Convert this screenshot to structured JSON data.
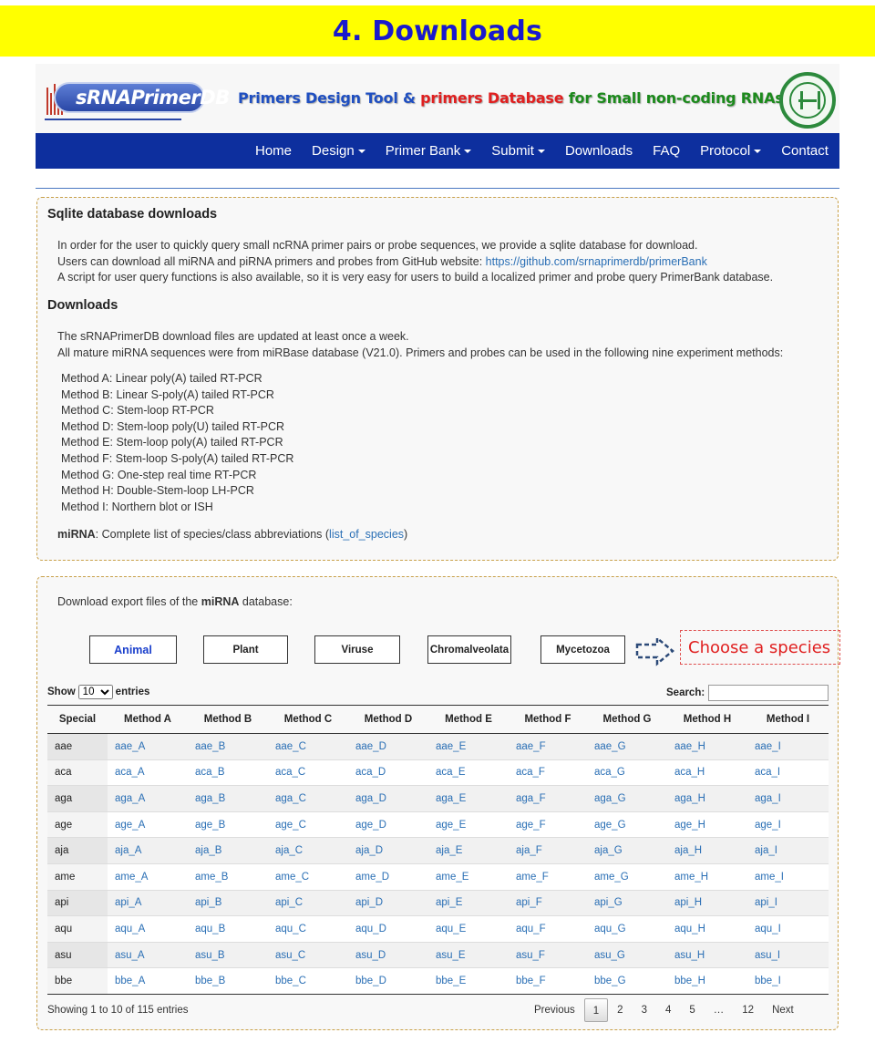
{
  "banner": {
    "title": "4. Downloads"
  },
  "header": {
    "logo_text": "sRNAPrimerDB",
    "tagline_part1": "Primers Design Tool & ",
    "tagline_part2": "primers Database",
    "tagline_part3": " for Small non-coding RNAs",
    "colors": {
      "nav": "#0d2f9e",
      "banner": "#ffff00",
      "link": "#2a6fb5"
    }
  },
  "nav": {
    "items": [
      {
        "label": "Home",
        "dropdown": false
      },
      {
        "label": "Design",
        "dropdown": true
      },
      {
        "label": "Primer Bank",
        "dropdown": true
      },
      {
        "label": "Submit",
        "dropdown": true
      },
      {
        "label": "Downloads",
        "dropdown": false
      },
      {
        "label": "FAQ",
        "dropdown": false
      },
      {
        "label": "Protocol",
        "dropdown": true
      },
      {
        "label": "Contact",
        "dropdown": false
      }
    ]
  },
  "sqlite": {
    "heading": "Sqlite database downloads",
    "line1": "In order for the user to quickly query small ncRNA primer pairs or probe sequences, we provide a sqlite database for download.",
    "line2_prefix": "Users can download all miRNA and piRNA primers and probes from GitHub website: ",
    "line2_link": "https://github.com/srnaprimerdb/primerBank",
    "line3": "A script for user query functions is also available, so it is very easy for users to build a localized primer and probe query PrimerBank database."
  },
  "downloads": {
    "heading": "Downloads",
    "line1": "The sRNAPrimerDB download files are updated at least once a week.",
    "line2": "All mature miRNA sequences were from miRBase database (V21.0). Primers and probes can be used in the following nine experiment methods:",
    "methods": [
      "Method A: Linear poly(A) tailed RT-PCR",
      "Method B: Linear S-poly(A) tailed RT-PCR",
      "Method C: Stem-loop RT-PCR",
      "Method D: Stem-loop poly(U) tailed RT-PCR",
      "Method E: Stem-loop poly(A) tailed RT-PCR",
      "Method F: Stem-loop S-poly(A) tailed RT-PCR",
      "Method G: One-step real time RT-PCR",
      "Method H: Double-Stem-loop LH-PCR",
      "Method I: Northern blot or ISH"
    ],
    "mirna_label": "miRNA",
    "mirna_text": ": Complete list of species/class abbreviations (",
    "mirna_link": "list_of_species",
    "mirna_close": ")"
  },
  "export": {
    "prefix": "Download export files of the ",
    "bold": "miRNA",
    "suffix": " database:",
    "species_buttons": [
      "Animal",
      "Plant",
      "Viruse",
      "Chromalveolata",
      "Mycetozoa"
    ],
    "selected": "Animal",
    "choose_hint": "Choose a species"
  },
  "table": {
    "show_label": "Show",
    "entries_label": "entries",
    "page_size": "10",
    "search_label": "Search:",
    "headers": [
      "Special",
      "Method A",
      "Method B",
      "Method C",
      "Method D",
      "Method E",
      "Method F",
      "Method G",
      "Method H",
      "Method I"
    ],
    "rows": [
      [
        "aae",
        "aae_A",
        "aae_B",
        "aae_C",
        "aae_D",
        "aae_E",
        "aae_F",
        "aae_G",
        "aae_H",
        "aae_I"
      ],
      [
        "aca",
        "aca_A",
        "aca_B",
        "aca_C",
        "aca_D",
        "aca_E",
        "aca_F",
        "aca_G",
        "aca_H",
        "aca_I"
      ],
      [
        "aga",
        "aga_A",
        "aga_B",
        "aga_C",
        "aga_D",
        "aga_E",
        "aga_F",
        "aga_G",
        "aga_H",
        "aga_I"
      ],
      [
        "age",
        "age_A",
        "age_B",
        "age_C",
        "age_D",
        "age_E",
        "age_F",
        "age_G",
        "age_H",
        "age_I"
      ],
      [
        "aja",
        "aja_A",
        "aja_B",
        "aja_C",
        "aja_D",
        "aja_E",
        "aja_F",
        "aja_G",
        "aja_H",
        "aja_I"
      ],
      [
        "ame",
        "ame_A",
        "ame_B",
        "ame_C",
        "ame_D",
        "ame_E",
        "ame_F",
        "ame_G",
        "ame_H",
        "ame_I"
      ],
      [
        "api",
        "api_A",
        "api_B",
        "api_C",
        "api_D",
        "api_E",
        "api_F",
        "api_G",
        "api_H",
        "api_I"
      ],
      [
        "aqu",
        "aqu_A",
        "aqu_B",
        "aqu_C",
        "aqu_D",
        "aqu_E",
        "aqu_F",
        "aqu_G",
        "aqu_H",
        "aqu_I"
      ],
      [
        "asu",
        "asu_A",
        "asu_B",
        "asu_C",
        "asu_D",
        "asu_E",
        "asu_F",
        "asu_G",
        "asu_H",
        "asu_I"
      ],
      [
        "bbe",
        "bbe_A",
        "bbe_B",
        "bbe_C",
        "bbe_D",
        "bbe_E",
        "bbe_F",
        "bbe_G",
        "bbe_H",
        "bbe_I"
      ]
    ],
    "info": "Showing 1 to 10 of 115 entries",
    "pagination": {
      "previous": "Previous",
      "pages": [
        "1",
        "2",
        "3",
        "4",
        "5",
        "…",
        "12"
      ],
      "current": "1",
      "next": "Next"
    }
  }
}
